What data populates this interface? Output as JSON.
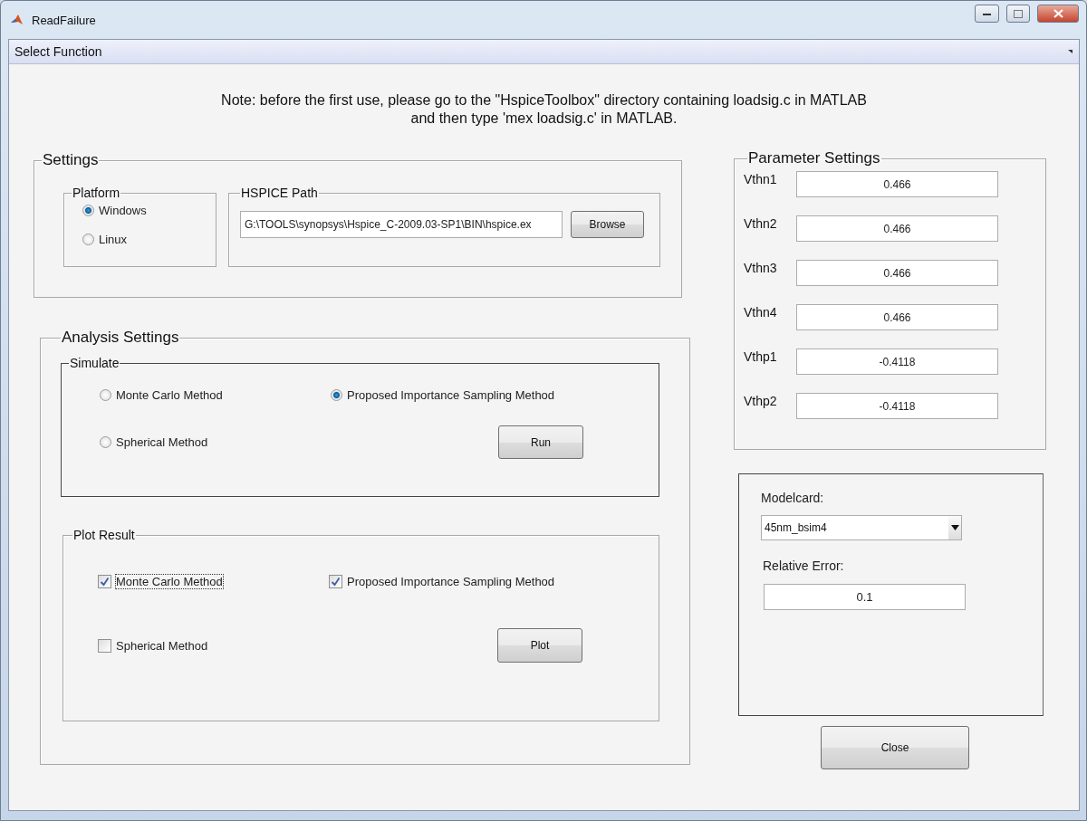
{
  "window": {
    "title": "ReadFailure"
  },
  "menu": {
    "label": "Select Function"
  },
  "note": "Note: before the first use, please go to the \"HspiceToolbox\" directory containing loadsig.c in MATLAB and then type 'mex loadsig.c' in MATLAB.",
  "settings": {
    "title": "Settings",
    "platform": {
      "title": "Platform",
      "options": [
        {
          "label": "Windows",
          "selected": true
        },
        {
          "label": "Linux",
          "selected": false
        }
      ]
    },
    "hspice_path": {
      "title": "HSPICE Path",
      "value": "G:\\TOOLS\\synopsys\\Hspice_C-2009.03-SP1\\BIN\\hspice.ex",
      "button": "Browse"
    }
  },
  "analysis": {
    "title": "Analysis Settings",
    "simulate": {
      "title": "Simulate",
      "options": [
        {
          "label": "Monte Carlo Method",
          "selected": false
        },
        {
          "label": "Proposed Importance Sampling Method",
          "selected": true
        },
        {
          "label": "Spherical Method",
          "selected": false
        }
      ],
      "button": "Run"
    },
    "plot_result": {
      "title": "Plot Result",
      "options": [
        {
          "label": "Monte Carlo Method",
          "checked": true,
          "focused": true
        },
        {
          "label": "Proposed Importance Sampling Method",
          "checked": true,
          "focused": false
        },
        {
          "label": "Spherical Method",
          "checked": false,
          "focused": false
        }
      ],
      "button": "Plot"
    }
  },
  "parameters": {
    "title": "Parameter Settings",
    "rows": [
      {
        "label": "Vthn1",
        "value": "0.466"
      },
      {
        "label": "Vthn2",
        "value": "0.466"
      },
      {
        "label": "Vthn3",
        "value": "0.466"
      },
      {
        "label": "Vthn4",
        "value": "0.466"
      },
      {
        "label": "Vthp1",
        "value": "-0.4118"
      },
      {
        "label": "Vthp2",
        "value": "-0.4118"
      }
    ]
  },
  "model": {
    "modelcard_label": "Modelcard:",
    "modelcard_value": "45nm_bsim4",
    "error_label": "Relative Error:",
    "error_value": "0.1"
  },
  "close_button": "Close"
}
